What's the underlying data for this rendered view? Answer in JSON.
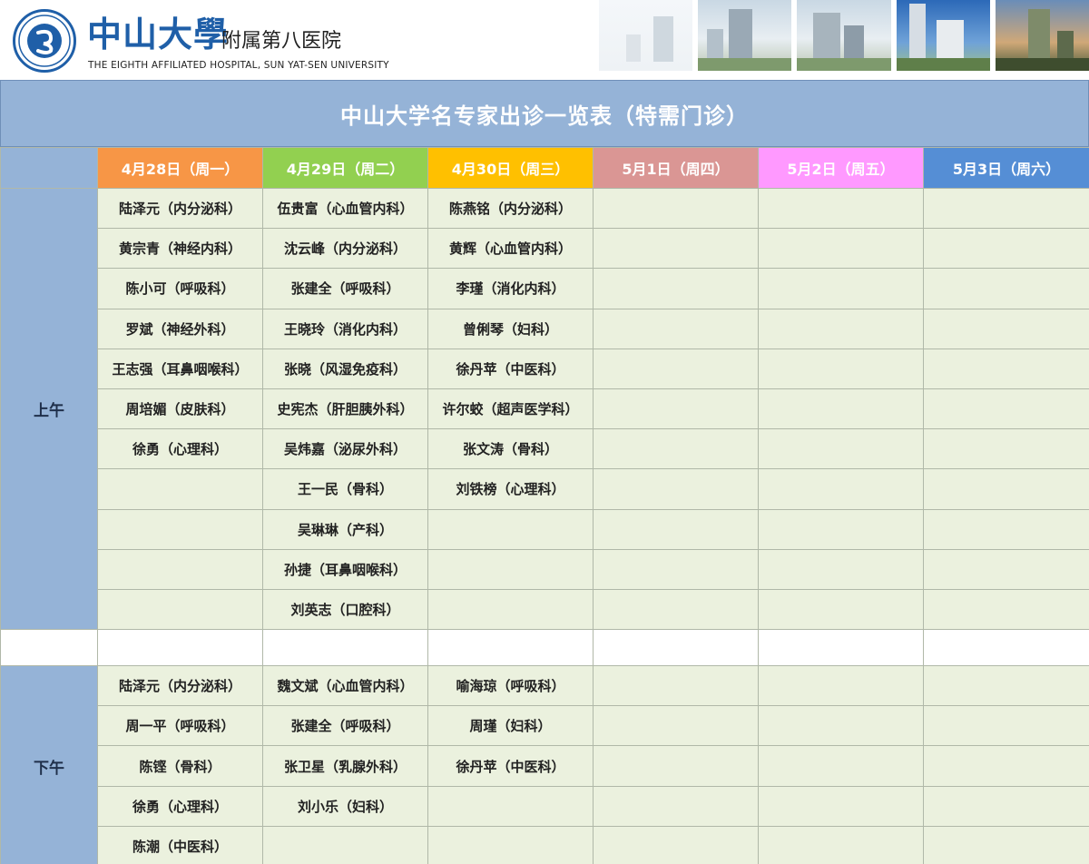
{
  "header": {
    "seal_text": "中山大学附属第八医院",
    "logo_main": "中山大學",
    "logo_sub": "附属第八医院",
    "logo_en": "THE EIGHTH AFFILIATED HOSPITAL, SUN YAT-SEN UNIVERSITY"
  },
  "title": "中山大学名专家出诊一览表（特需门诊）",
  "days": [
    {
      "label": "4月28日（周一）",
      "color": "#f79646"
    },
    {
      "label": "4月29日（周二）",
      "color": "#92d050"
    },
    {
      "label": "4月30日（周三）",
      "color": "#ffc000"
    },
    {
      "label": "5月1日（周四）",
      "color": "#da9694"
    },
    {
      "label": "5月2日（周五）",
      "color": "#ff99ff"
    },
    {
      "label": "5月3日（周六）",
      "color": "#558ed5"
    }
  ],
  "morning": {
    "label": "上午",
    "rows": [
      [
        "陆泽元（内分泌科）",
        "伍贵富（心血管内科）",
        "陈燕铭（内分泌科）",
        "",
        "",
        ""
      ],
      [
        "黄宗青（神经内科）",
        "沈云峰（内分泌科）",
        "黄辉（心血管内科）",
        "",
        "",
        ""
      ],
      [
        "陈小可（呼吸科）",
        "张建全（呼吸科）",
        "李瑾（消化内科）",
        "",
        "",
        ""
      ],
      [
        "罗斌（神经外科）",
        "王晓玲（消化内科）",
        "曾俐琴（妇科）",
        "",
        "",
        ""
      ],
      [
        "王志强（耳鼻咽喉科）",
        "张晓（风湿免疫科）",
        "徐丹苹（中医科）",
        "",
        "",
        ""
      ],
      [
        "周培媚（皮肤科）",
        "史宪杰（肝胆胰外科）",
        "许尔蛟（超声医学科）",
        "",
        "",
        ""
      ],
      [
        "徐勇（心理科）",
        "吴炜嘉（泌尿外科）",
        "张文涛（骨科）",
        "",
        "",
        ""
      ],
      [
        "",
        "王一民（骨科）",
        "刘铁榜（心理科）",
        "",
        "",
        ""
      ],
      [
        "",
        "吴琳琳（产科）",
        "",
        "",
        "",
        ""
      ],
      [
        "",
        "孙捷（耳鼻咽喉科）",
        "",
        "",
        "",
        ""
      ],
      [
        "",
        "刘英志（口腔科）",
        "",
        "",
        "",
        ""
      ]
    ]
  },
  "afternoon": {
    "label": "下午",
    "rows": [
      [
        "陆泽元（内分泌科）",
        "魏文斌（心血管内科）",
        "喻海琼（呼吸科）",
        "",
        "",
        ""
      ],
      [
        "周一平（呼吸科）",
        "张建全（呼吸科）",
        "周瑾（妇科）",
        "",
        "",
        ""
      ],
      [
        "陈铿（骨科）",
        "张卫星（乳腺外科）",
        "徐丹苹（中医科）",
        "",
        "",
        ""
      ],
      [
        "徐勇（心理科）",
        "刘小乐（妇科）",
        "",
        "",
        "",
        ""
      ],
      [
        "陈潮（中医科）",
        "",
        "",
        "",
        "",
        ""
      ]
    ]
  }
}
